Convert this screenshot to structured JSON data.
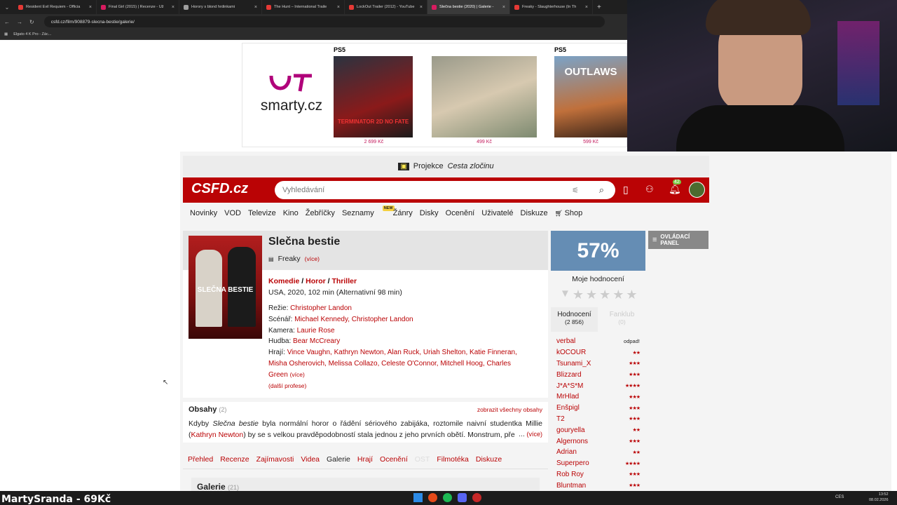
{
  "browser": {
    "tabs": [
      {
        "title": "Resident Evil Requiem - Officia",
        "color": "#e53935",
        "active": false
      },
      {
        "title": "Final Girl (2015) | Recenze - Už",
        "color": "#d81b60",
        "active": false
      },
      {
        "title": "Horory s blond hrdinkami",
        "color": "#9e9e9e",
        "active": false
      },
      {
        "title": "The Hunt – International Traile",
        "color": "#e53935",
        "active": false
      },
      {
        "title": "LockOut Trailer (2012) - YouTube",
        "color": "#e53935",
        "active": false
      },
      {
        "title": "Slečna bestie (2020) | Galerie -",
        "color": "#d81b60",
        "active": true
      },
      {
        "title": "Freaky - Slaughterhouse (In Th",
        "color": "#e53935",
        "active": false
      }
    ],
    "url": "csfd.cz/film/908879-slecna-bestie/galerie/",
    "bookmark": "Elgato 4 K Pro - Zác..."
  },
  "ad": {
    "brand": "smarty.cz",
    "badge": "PS5",
    "products": [
      {
        "title": "TERMINATOR 2D NO FATE",
        "price": "2 699 Kč"
      },
      {
        "title": "",
        "price": "499 Kč"
      },
      {
        "title": "OUTLAWS",
        "price": "599 Kč"
      }
    ]
  },
  "promo": {
    "prefix": "Projekce",
    "title": "Cesta zločinu"
  },
  "header": {
    "logo": "CSFD.cz",
    "search_placeholder": "Vyhledávání",
    "notif_count": "42"
  },
  "nav": [
    "Novinky",
    "VOD",
    "Televize",
    "Kino",
    "Žebříčky",
    "Seznamy",
    "Žánry",
    "Disky",
    "Ocenění",
    "Uživatelé",
    "Diskuze",
    "Shop"
  ],
  "nav_new_badge": "NEW",
  "film": {
    "title": "Slečna bestie",
    "alt_title": "Freaky",
    "alt_more": "(více)",
    "genres": [
      "Komedie",
      "Horor",
      "Thriller"
    ],
    "origin": "USA, 2020, 102 min (Alternativní 98 min)",
    "credits": [
      {
        "label": "Režie:",
        "names": "Christopher Landon"
      },
      {
        "label": "Scénář:",
        "names": "Michael Kennedy, Christopher Landon"
      },
      {
        "label": "Kamera:",
        "names": "Laurie Rose"
      },
      {
        "label": "Hudba:",
        "names": "Bear McCreary"
      },
      {
        "label": "Hrají:",
        "names": "Vince Vaughn, Kathryn Newton, Alan Ruck, Uriah Shelton, Katie Finneran, Misha Osherovich, Melissa Collazo, Celeste O'Connor, Mitchell Hoog, Charles Green"
      }
    ],
    "cast_more": "(více)",
    "more_prof": "(další profese)",
    "poster_title": "SLEČNA BESTIE"
  },
  "rating": {
    "percent": "57%",
    "mine_label": "Moje hodnocení",
    "tab_ratings": "Hodnocení",
    "tab_ratings_count": "(2 856)",
    "tab_fanclub": "Fanklub",
    "tab_fanclub_count": "(0)",
    "odpad": "odpad!",
    "list": [
      {
        "name": "verbal",
        "stars": ""
      },
      {
        "name": "kOCOUR",
        "stars": "★★"
      },
      {
        "name": "Tsunami_X",
        "stars": "★★★"
      },
      {
        "name": "Blizzard",
        "stars": "★★★"
      },
      {
        "name": "J*A*S*M",
        "stars": "★★★★"
      },
      {
        "name": "MrHlad",
        "stars": "★★★"
      },
      {
        "name": "Enšpigl",
        "stars": "★★★"
      },
      {
        "name": "T2",
        "stars": "★★★"
      },
      {
        "name": "gouryella",
        "stars": "★★"
      },
      {
        "name": "Algernons",
        "stars": "★★★"
      },
      {
        "name": "Adrian",
        "stars": "★★"
      },
      {
        "name": "Superpero",
        "stars": "★★★★"
      },
      {
        "name": "Rob Roy",
        "stars": "★★★"
      },
      {
        "name": "Bluntman",
        "stars": "★★★"
      }
    ]
  },
  "control_panel": "OVLÁDACÍ PANEL",
  "obsahy": {
    "title": "Obsahy",
    "count": "(2)",
    "show_all": "zobrazit všechny obsahy",
    "text_1": "Kdyby ",
    "text_italic": "Slečna bestie",
    "text_2": " byla normální horor o řádění sériového zabijáka, roztomile naivní studentka Millie (",
    "actor": "Kathryn Newton",
    "text_3": ") by se s velkou pravděpodobností stala jednou z jeho prvních obětí. Monstrum, pře",
    "ellipsis": "…",
    "more": "(více)"
  },
  "film_tabs": [
    "Přehled",
    "Recenze",
    "Zajímavosti",
    "Videa",
    "Galerie",
    "Hrají",
    "Ocenění",
    "OST",
    "Filmotéka",
    "Diskuze"
  ],
  "gallery_heading": "Galerie",
  "gallery_count": "(21)",
  "overlay": "MartySranda - 69Kč",
  "taskbar": {
    "lang": "CES",
    "time": "13:52",
    "date": "08.02.2026"
  }
}
